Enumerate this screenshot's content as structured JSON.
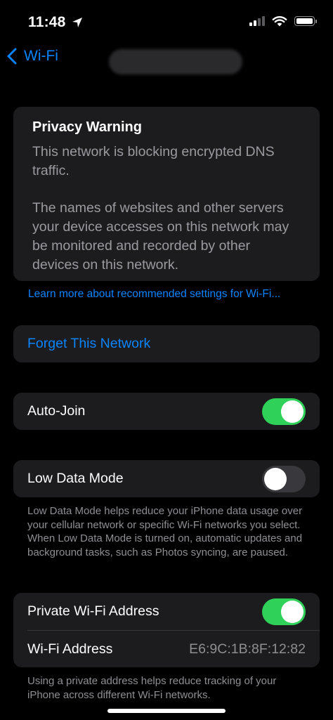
{
  "status_bar": {
    "time": "11:48",
    "location_icon": "location-arrow-icon",
    "signal_icon": "cellular-signal-icon",
    "wifi_icon": "wifi-icon",
    "battery_icon": "battery-icon"
  },
  "nav": {
    "back_label": "Wi-Fi"
  },
  "privacy_warning": {
    "title": "Privacy Warning",
    "paragraph1": "This network is blocking encrypted DNS traffic.",
    "paragraph2": "The names of websites and other servers your device accesses on this network may be monitored and recorded by other devices on this network."
  },
  "learn_more_link": "Learn more about recommended settings for Wi-Fi...",
  "forget_network": "Forget This Network",
  "auto_join": {
    "label": "Auto-Join",
    "on": true
  },
  "low_data_mode": {
    "label": "Low Data Mode",
    "on": false,
    "footnote": "Low Data Mode helps reduce your iPhone data usage over your cellular network or specific Wi-Fi networks you select. When Low Data Mode is turned on, automatic updates and background tasks, such as Photos syncing, are paused."
  },
  "private_address": {
    "label": "Private Wi-Fi Address",
    "on": true,
    "address_label": "Wi-Fi Address",
    "address_value": "E6:9C:1B:8F:12:82",
    "footnote": "Using a private address helps reduce tracking of your iPhone across different Wi-Fi networks."
  },
  "colors": {
    "accent": "#0a84ff",
    "toggle_on": "#30d158",
    "toggle_off": "#39393d",
    "cell_background": "#1c1c1e"
  }
}
